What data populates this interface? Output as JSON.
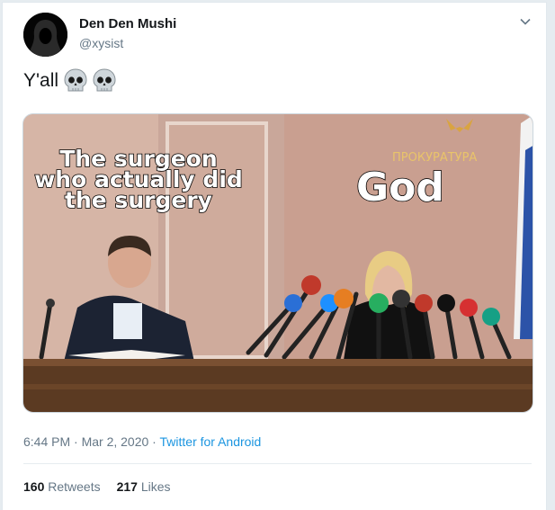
{
  "tweet": {
    "author_name": "Den Den Mushi",
    "author_handle": "@xysist",
    "text": "Y'all",
    "emoji_icons": [
      "skull-icon",
      "skull-icon"
    ],
    "media": {
      "caption_left": "The surgeon who actually did the surgery",
      "caption_right": "God",
      "sign_text": "ПРОКУРАТУРА"
    },
    "time": "6:44 PM · Mar 2, 2020",
    "separator": " · ",
    "client": "Twitter for Android",
    "retweets_count": "160",
    "retweets_label": "Retweets",
    "likes_count": "217",
    "likes_label": "Likes"
  },
  "colors": {
    "link": "#1b95e0",
    "secondary": "#657786",
    "border": "#e1e8ed"
  }
}
